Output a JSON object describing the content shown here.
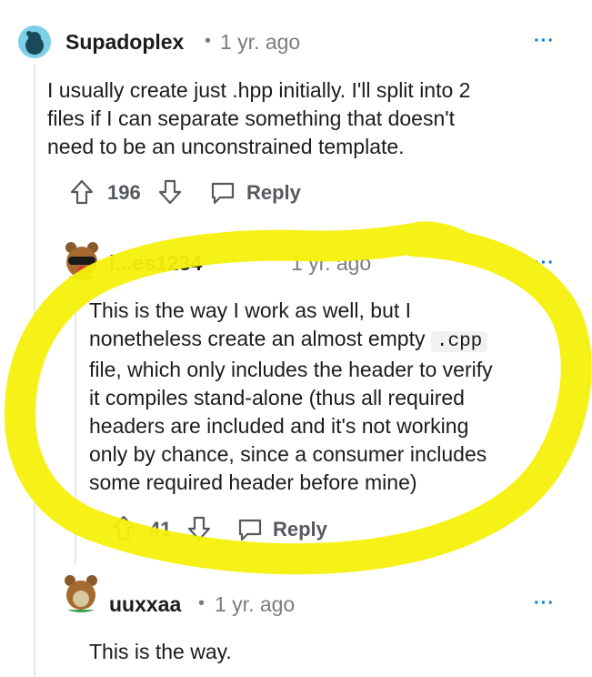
{
  "comments": [
    {
      "username": "Supadoplex",
      "separator": "•",
      "age": "1 yr. ago",
      "more": "···",
      "lines": [
        "I usually create just .hpp initially. I'll split into 2",
        "files if I can separate something that doesn't",
        "need to be an unconstrained template."
      ],
      "votes": "196",
      "reply": "Reply"
    },
    {
      "username": "i...es1234",
      "age": "1 yr. ago",
      "more": "···",
      "line1": "This is the way I work as well, but I",
      "line2_pre": "nonetheless create an almost empty",
      "line2_code": ".cpp",
      "lines_rest": [
        "file, which only includes the header to verify",
        "it compiles stand-alone (thus all required",
        "headers are included and it's not working",
        "only by chance, since a consumer includes",
        "some required header before mine)"
      ],
      "votes": "41",
      "reply": "Reply"
    },
    {
      "username": "uuxxaa",
      "separator": "•",
      "age": "1 yr. ago",
      "more": "···",
      "lines": [
        "This is the way."
      ]
    }
  ],
  "colors": {
    "highlight": "#f6f00a",
    "accent": "#0079d3",
    "avatar_blue": "#7ecfe8"
  }
}
